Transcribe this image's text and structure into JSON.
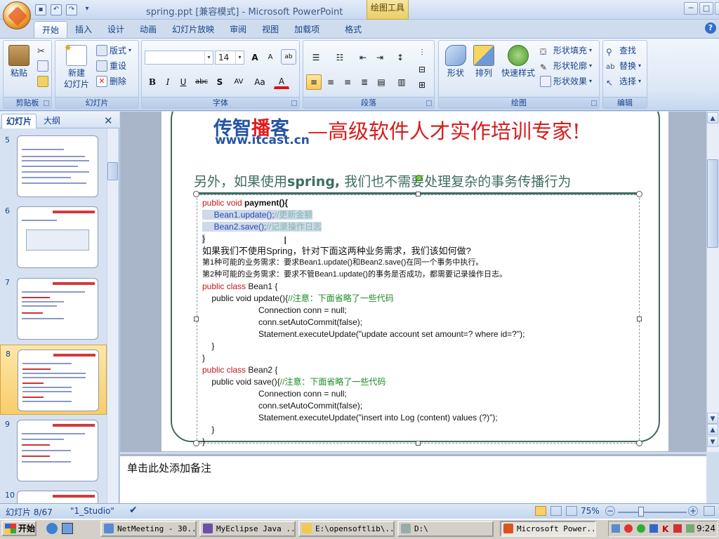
{
  "window": {
    "title": "spring.ppt [兼容模式] - Microsoft PowerPoint",
    "contextual_tab_title": "绘图工具",
    "min_glyph": "─",
    "max_glyph": "□"
  },
  "tabs": [
    "开始",
    "插入",
    "设计",
    "动画",
    "幻灯片放映",
    "审阅",
    "视图",
    "加载项",
    "格式"
  ],
  "ribbon": {
    "clipboard": {
      "label": "剪贴板",
      "paste": "粘贴"
    },
    "slides": {
      "label": "幻灯片",
      "new_slide_1": "新建",
      "new_slide_2": "幻灯片",
      "layout": "版式",
      "reset": "重设",
      "delete": "删除"
    },
    "font": {
      "label": "字体",
      "font_size": "14",
      "grow": "A",
      "shrink": "A",
      "bold": "B",
      "italic": "I",
      "underline": "U",
      "strike": "abc",
      "shadow": "S",
      "spacing": "AV",
      "case": "Aa",
      "color": "A"
    },
    "paragraph": {
      "label": "段落"
    },
    "drawing": {
      "label": "绘图",
      "shapes": "形状",
      "arrange": "排列",
      "quick_styles": "快速样式",
      "shape_fill": "形状填充",
      "shape_outline": "形状轮廓",
      "shape_effects": "形状效果"
    },
    "editing": {
      "label": "编辑",
      "find": "查找",
      "replace": "替换",
      "select": "选择"
    }
  },
  "left_pane": {
    "tab_slides": "幻灯片",
    "tab_outline": "大纲",
    "slide_numbers": [
      "5",
      "6",
      "7",
      "8",
      "9",
      "10"
    ]
  },
  "slide": {
    "brand_a": "传智",
    "brand_b": "播",
    "brand_c": "客",
    "brand_url": "www.itcast.cn",
    "slogan": "—高级软件人才实作培训专家!",
    "subtitle_a": "另外，如果使用",
    "subtitle_b": "spring,",
    "subtitle_c": " 我们也不需要处理复杂的事务传播行为",
    "code": {
      "l1_kw": "public void ",
      "l1_rest": "payment(){",
      "l2_code": "Bean1.update();",
      "l2_cm": "//更新金额",
      "l3_code": "Bean2.save();",
      "l3_cm": "//记录操作日志",
      "l4": "}",
      "q": "如果我们不使用Spring，针对下面这两种业务需求，我们该如何做?",
      "r1": "第1种可能的业务需求：要求Bean1.update()和Bean2.save()在同一个事务中执行。",
      "r2": "第2种可能的业务需求：要求不管Bean1.update()的事务是否成功，都需要记录操作日志。",
      "c1_kw": "public class ",
      "c1_name": "Bean1 {",
      "c1_m": "public void update(){",
      "c1_cm": "//注意：下面省略了一些代码",
      "c1_a": "Connection conn = null;",
      "c1_b": "conn.setAutoCommit(false);",
      "c1_c": "Statement.executeUpdate(\"update account set amount=? where id=?\");",
      "close1": "}",
      "close2": "}",
      "c2_kw": "public class ",
      "c2_name": "Bean2 {",
      "c2_m": "public void save(){",
      "c2_cm": "//注意：下面省略了一些代码",
      "c2_a": "Connection conn = null;",
      "c2_b": "conn.setAutoCommit(false);",
      "c2_c": "Statement.executeUpdate(\"insert into Log (content) values (?)\");",
      "close3": "}",
      "close4": "}"
    }
  },
  "notes_placeholder": "单击此处添加备注",
  "status": {
    "slide_info": "幻灯片 8/67",
    "theme": "\"1_Studio\"",
    "zoom": "75%"
  },
  "taskbar": {
    "start": "开始",
    "items": [
      "NetMeeting - 30...",
      "MyEclipse Java ...",
      "E:\\opensoftlib\\...",
      "D:\\",
      "Microsoft Power..."
    ],
    "clock": "9:24"
  },
  "colors": {
    "accent_red": "#d81c1c",
    "brand_blue": "#2554a3",
    "frame_green": "#44685a"
  }
}
